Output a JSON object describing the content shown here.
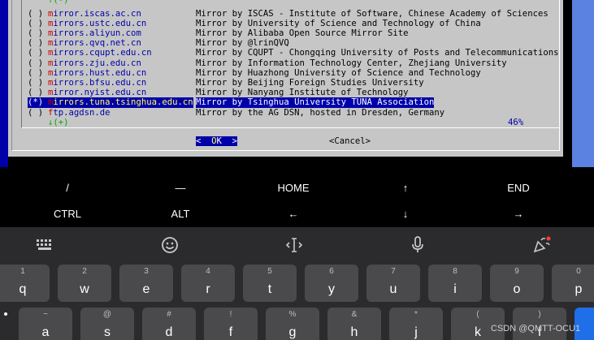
{
  "terminal": {
    "scroll_up": "↑(-)",
    "scroll_down": "↓(+)",
    "scroll_percent": "46%",
    "mirrors": [
      {
        "radio": "( )",
        "key": "m",
        "rest": "irror.iscas.ac.cn",
        "desc": "Mirror by ISCAS - Institute of Software, Chinese Academy of Sciences"
      },
      {
        "radio": "( )",
        "key": "m",
        "rest": "irrors.ustc.edu.cn",
        "desc": "Mirror by University of Science and Technology of China"
      },
      {
        "radio": "( )",
        "key": "m",
        "rest": "irrors.aliyun.com",
        "desc": "Mirror by Alibaba Open Source Mirror Site"
      },
      {
        "radio": "( )",
        "key": "m",
        "rest": "irrors.qvq.net.cn",
        "desc": "Mirror by @lrinQVQ"
      },
      {
        "radio": "( )",
        "key": "m",
        "rest": "irrors.cqupt.edu.cn",
        "desc": "Mirror by CQUPT - Chongqing University of Posts and Telecommunications"
      },
      {
        "radio": "( )",
        "key": "m",
        "rest": "irrors.zju.edu.cn",
        "desc": "Mirror by Information Technology Center, Zhejiang University"
      },
      {
        "radio": "( )",
        "key": "m",
        "rest": "irrors.hust.edu.cn",
        "desc": "Mirror by Huazhong University of Science and Technology"
      },
      {
        "radio": "( )",
        "key": "m",
        "rest": "irrors.bfsu.edu.cn",
        "desc": "Mirror by Beijing Foreign Studies University"
      },
      {
        "radio": "( )",
        "key": "m",
        "rest": "irror.nyist.edu.cn",
        "desc": "Mirror by Nanyang Institute of Technology"
      },
      {
        "radio": "(*)",
        "key": "m",
        "rest": "irrors.tuna.tsinghua.edu.cn",
        "desc": "Mirror by Tsinghua University TUNA Association"
      },
      {
        "radio": "( )",
        "key": "f",
        "rest": "tp.agdsn.de",
        "desc": "Mirror by the AG DSN, hosted in Dresden, Germany"
      }
    ],
    "selected_index": 9,
    "ok": {
      "left": "<  ",
      "hk": "O",
      "rest": "K  >"
    },
    "cancel": "<Cancel>"
  },
  "extra_keys": {
    "row1": [
      "/",
      "—",
      "HOME",
      "↑",
      "END"
    ],
    "row2": [
      "CTRL",
      "ALT",
      "←",
      "↓",
      "→"
    ]
  },
  "keyboard": {
    "toolbar": [
      "keyboard-grid-icon",
      "emoji-icon",
      "text-cursor-icon",
      "microphone-icon",
      "party-popper-icon"
    ],
    "row1": [
      {
        "num": "1",
        "letter": "q"
      },
      {
        "num": "2",
        "letter": "w"
      },
      {
        "num": "3",
        "letter": "e"
      },
      {
        "num": "4",
        "letter": "r"
      },
      {
        "num": "5",
        "letter": "t"
      },
      {
        "num": "6",
        "letter": "y"
      },
      {
        "num": "7",
        "letter": "u"
      },
      {
        "num": "8",
        "letter": "i"
      },
      {
        "num": "9",
        "letter": "o"
      },
      {
        "num": "0",
        "letter": "p"
      }
    ],
    "row2": [
      {
        "sym": "~",
        "letter": "a"
      },
      {
        "sym": "@",
        "letter": "s"
      },
      {
        "sym": "#",
        "letter": "d"
      },
      {
        "sym": "!",
        "letter": "f"
      },
      {
        "sym": "%",
        "letter": "g"
      },
      {
        "sym": "&",
        "letter": "h"
      },
      {
        "sym": "*",
        "letter": "j"
      },
      {
        "sym": "(",
        "letter": "k"
      },
      {
        "sym": ")",
        "letter": "l"
      }
    ],
    "accent_color": "#1e6fe8"
  },
  "watermark": "CSDN @QMTT-OCU1"
}
